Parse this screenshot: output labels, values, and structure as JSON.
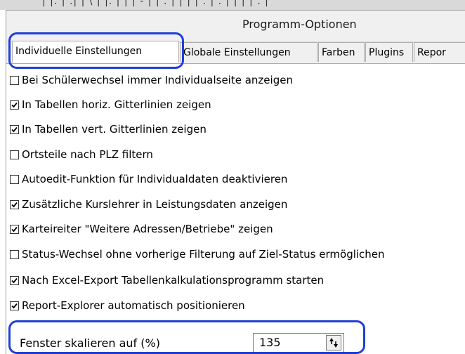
{
  "window": {
    "title": "Programm-Optionen"
  },
  "tabs": [
    {
      "label": "Individuelle Einstellungen",
      "active": true
    },
    {
      "label": "Globale Einstellungen",
      "active": false
    },
    {
      "label": "Farben",
      "active": false
    },
    {
      "label": "Plugins",
      "active": false
    },
    {
      "label": "Repor",
      "active": false
    }
  ],
  "options": [
    {
      "label": "Bei Schülerwechsel immer Individualseite anzeigen",
      "checked": false
    },
    {
      "label": "In Tabellen horiz. Gitterlinien zeigen",
      "checked": true
    },
    {
      "label": "In Tabellen vert. Gitterlinien zeigen",
      "checked": true
    },
    {
      "label": "Ortsteile nach PLZ filtern",
      "checked": false
    },
    {
      "label": "Autoedit-Funktion für Individualdaten deaktivieren",
      "checked": false
    },
    {
      "label": "Zusätzliche Kurslehrer in Leistungsdaten anzeigen",
      "checked": true
    },
    {
      "label": "Karteireiter \"Weitere Adressen/Betriebe\" zeigen",
      "checked": true
    },
    {
      "label": "Status-Wechsel ohne vorherige Filterung auf Ziel-Status ermöglichen",
      "checked": false
    },
    {
      "label": "Nach Excel-Export Tabellenkalkulationsprogramm starten",
      "checked": true
    },
    {
      "label": "Report-Explorer automatisch positionieren",
      "checked": true
    }
  ],
  "scale": {
    "label": "Fenster skalieren auf (%)",
    "value": "135"
  },
  "highlight_color": "#1f3fd6"
}
